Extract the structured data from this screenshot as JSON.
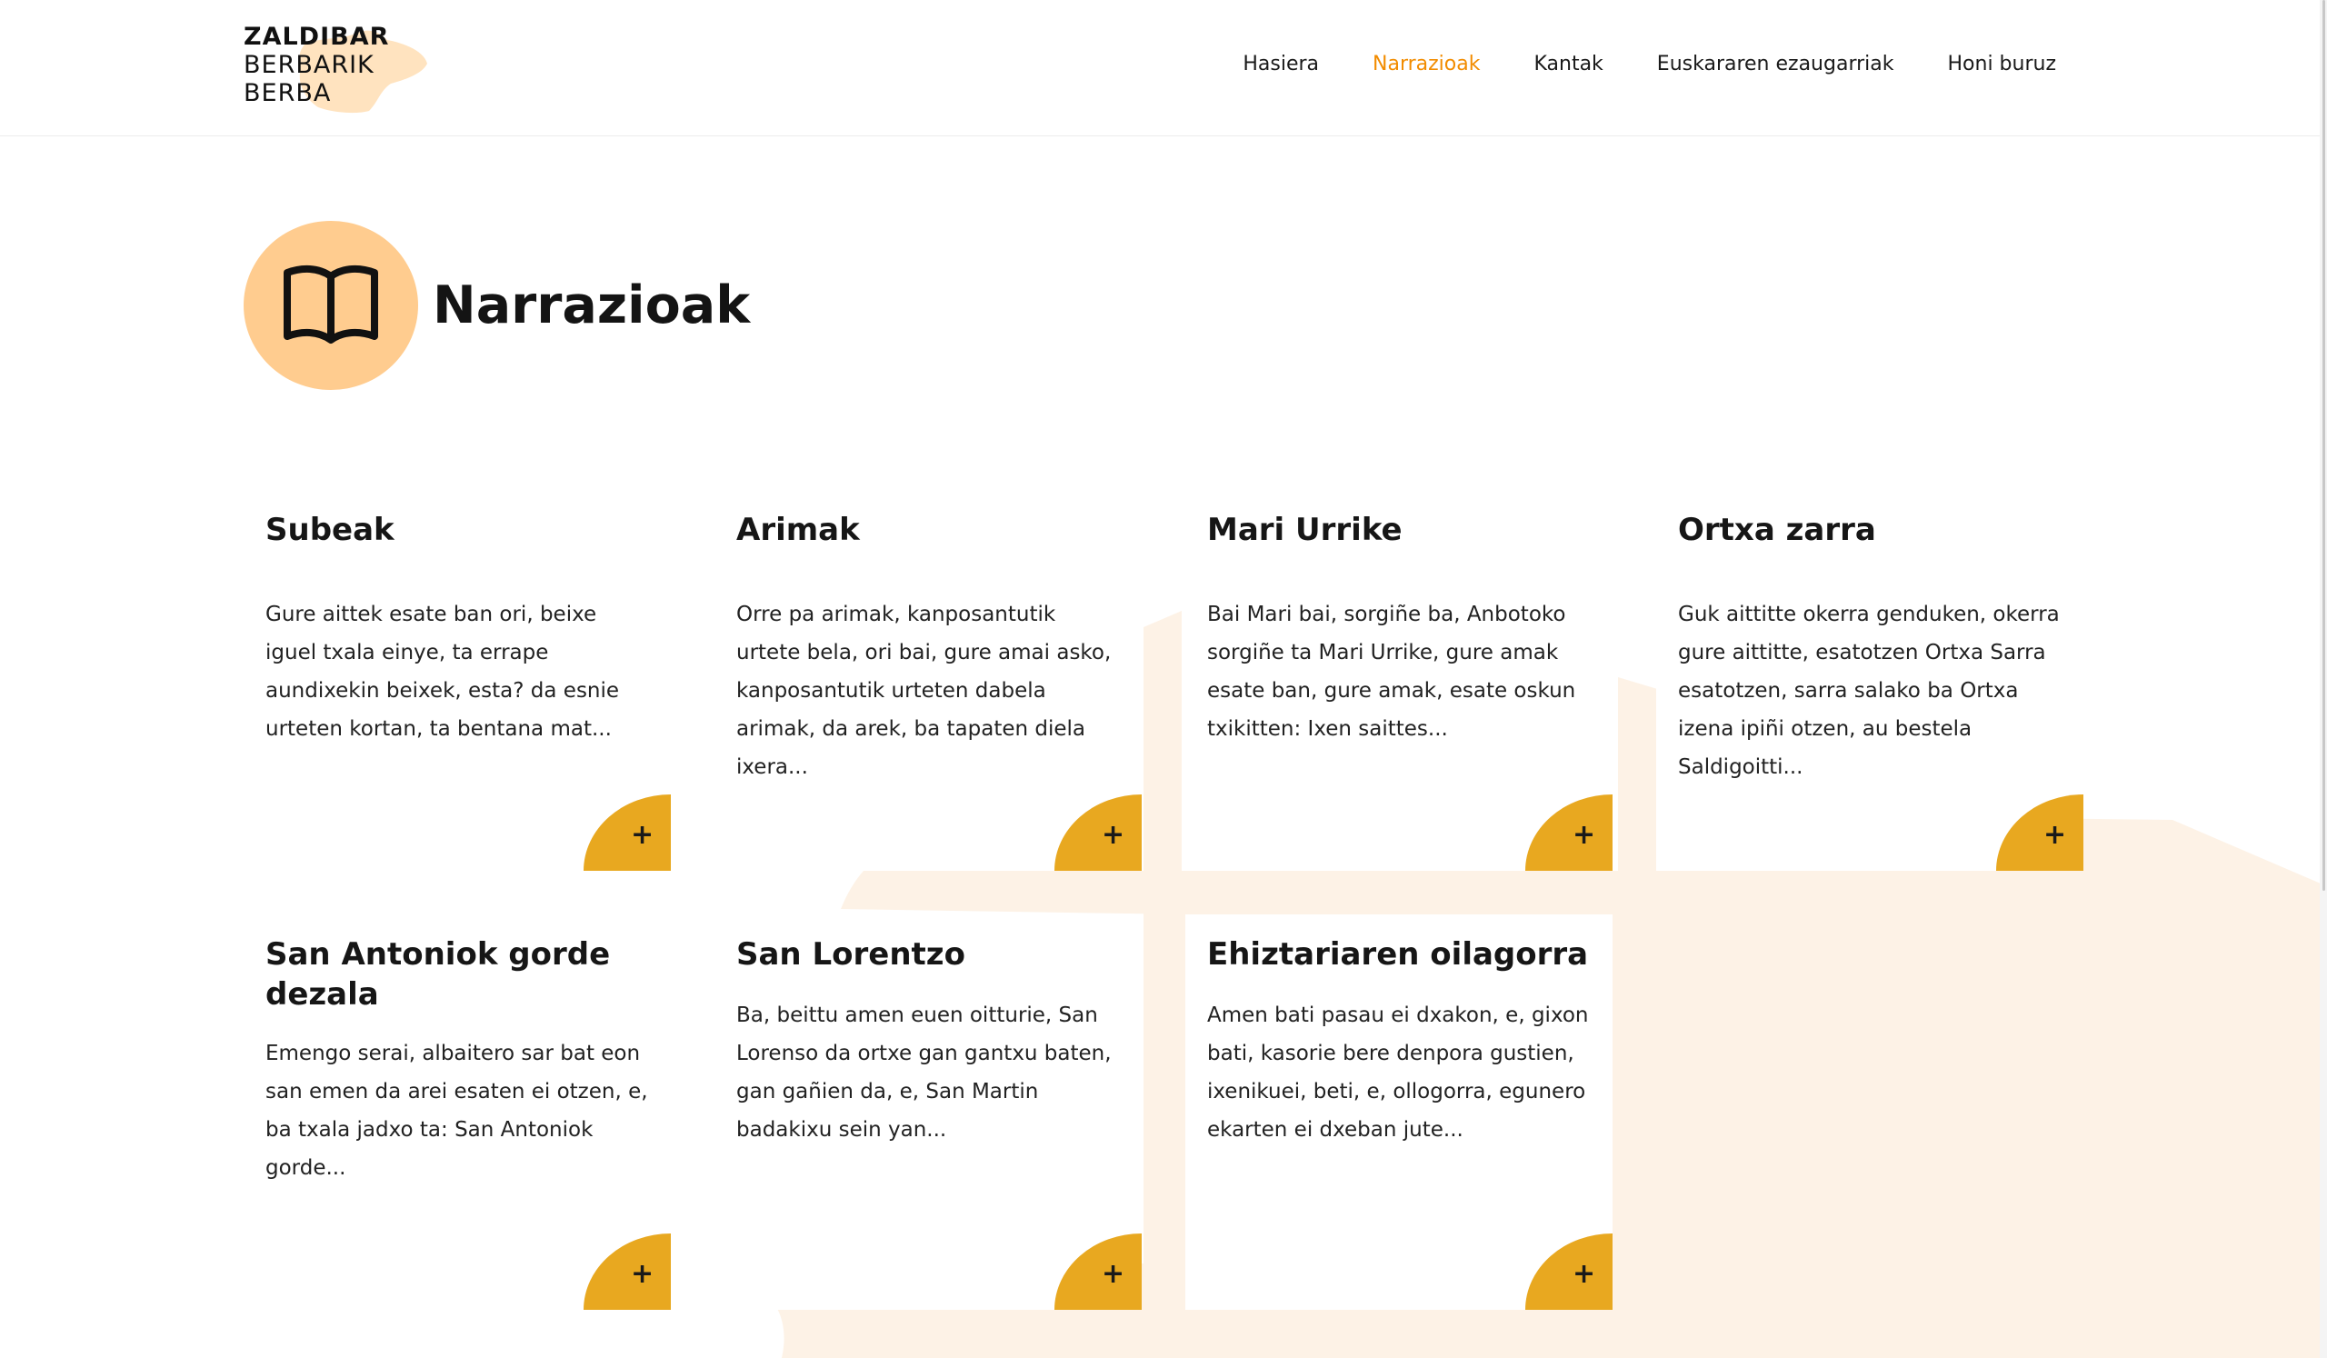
{
  "logo": {
    "line1": "ZALDIBAR",
    "line2": "BERBARIK",
    "line3": "BERBA"
  },
  "nav": {
    "items": [
      {
        "label": "Hasiera",
        "active": false
      },
      {
        "label": "Narrazioak",
        "active": true
      },
      {
        "label": "Kantak",
        "active": false
      },
      {
        "label": "Euskararen ezaugarriak",
        "active": false
      },
      {
        "label": "Honi buruz",
        "active": false
      }
    ]
  },
  "page": {
    "title": "Narrazioak",
    "icon": "book-icon"
  },
  "cards": [
    {
      "title": "Subeak",
      "excerpt": "Gure aittek esate ban ori, beixe iguel txala einye, ta errape aundixekin beixek, esta? da esnie urteten kortan, ta bentana mat...",
      "more_label": "+"
    },
    {
      "title": "Arimak",
      "excerpt": "Orre pa arimak, kanposantutik urtete bela, ori bai, gure amai asko, kanposantutik urteten dabela arimak, da arek, ba tapaten diela ixera...",
      "more_label": "+"
    },
    {
      "title": "Mari Urrike",
      "excerpt": "Bai Mari bai, sorgiñe ba, Anbotoko sorgiñe ta Mari Urrike, gure amak esate ban, gure amak, esate oskun txikitten: Ixen saittes...",
      "more_label": "+"
    },
    {
      "title": "Ortxa zarra",
      "excerpt": "Guk aittitte okerra genduken, okerra gure aittitte, esatotzen Ortxa Sarra esatotzen, sarra salako ba Ortxa izena ipiñi otzen, au bestela Saldigoitti...",
      "more_label": "+"
    },
    {
      "title": "San Antoniok gorde dezala",
      "excerpt": "Emengo serai, albaitero sar bat eon san emen da arei esaten ei otzen, e, ba txala jadxo ta: San Antoniok gorde...",
      "more_label": "+"
    },
    {
      "title": "San Lorentzo",
      "excerpt": "Ba, beittu amen euen oitturie, San Lorenso da ortxe gan gantxu baten, gan gañien da, e, San Martin badakixu sein yan...",
      "more_label": "+"
    },
    {
      "title": "Ehiztariaren oilagorra",
      "excerpt": "Amen bati pasau ei dxakon, e, gixon bati, kasorie bere denpora gustien, ixenikuei, beti, e, ollogorra, egunero ekarten ei dxeban jute...",
      "more_label": "+"
    }
  ],
  "colors": {
    "accent": "#f28c00",
    "button": "#e8a820",
    "title_circle": "#ffcc8f",
    "background_blob": "#fdf2e6"
  }
}
